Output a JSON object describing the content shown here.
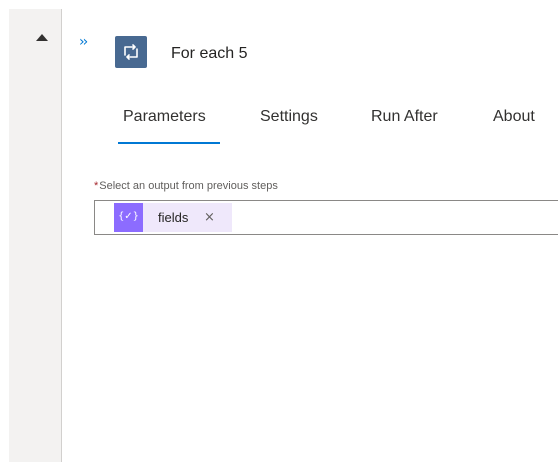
{
  "action": {
    "title": "For each 5",
    "icon": "loop-icon",
    "icon_color": "#486991"
  },
  "tabs": [
    {
      "label": "Parameters",
      "active": true
    },
    {
      "label": "Settings",
      "active": false
    },
    {
      "label": "Run After",
      "active": false
    },
    {
      "label": "About",
      "active": false
    }
  ],
  "field": {
    "required_marker": "*",
    "label": "Select an output from previous steps",
    "token": {
      "icon_glyph": "{✓}",
      "label": "fields",
      "remove": "×",
      "color": "#8c6cff"
    }
  },
  "accent_color": "#0078d4"
}
